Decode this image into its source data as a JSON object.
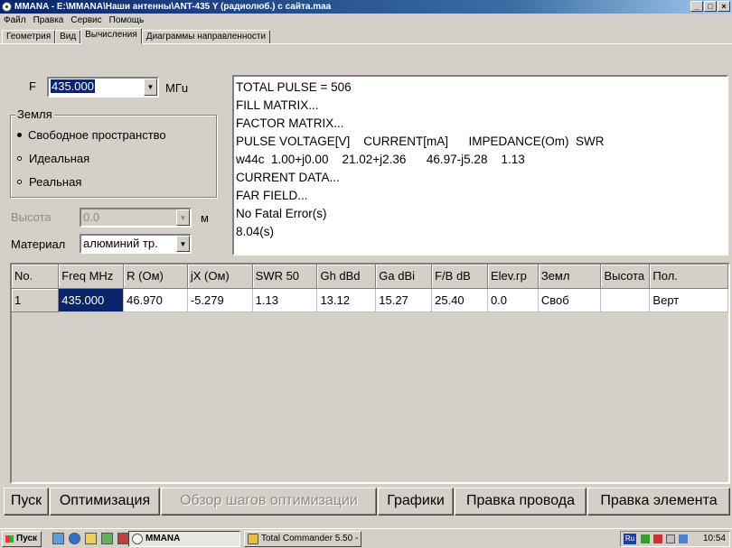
{
  "window": {
    "title": "MMANA - E:\\MMANA\\Наши антенны\\ANT-435 Y (радиолюб.) с сайта.maa",
    "minimize": "_",
    "maximize": "□",
    "close": "×"
  },
  "menu": [
    "Файл",
    "Правка",
    "Сервис",
    "Помощь"
  ],
  "tabs": [
    "Геометрия",
    "Вид",
    "Вычисления",
    "Диаграммы направленности"
  ],
  "active_tab": "Вычисления",
  "freq": {
    "label": "F",
    "value": "435.000",
    "unit": "MГu"
  },
  "ground": {
    "title": "Земля",
    "options": [
      "Свободное пространство",
      "Идеальная",
      "Реальная"
    ],
    "selected": "Свободное пространство"
  },
  "height": {
    "label": "Высота",
    "value": "0.0",
    "unit": "м"
  },
  "material": {
    "label": "Материал",
    "value": "алюминий тр."
  },
  "log_lines": [
    "TOTAL PULSE = 506",
    "FILL MATRIX...",
    "FACTOR MATRIX...",
    "PULSE VOLTAGE[V]    CURRENT[mA]      IMPEDANCE(Om)  SWR",
    "w44c  1.00+j0.00    21.02+j2.36      46.97-j5.28    1.13",
    "CURRENT DATA...",
    "FAR FIELD...",
    "No Fatal Error(s)",
    "8.04(s)"
  ],
  "grid": {
    "headers": [
      "No.",
      "Freq MHz",
      "R (Ом)",
      "jX (Ом)",
      "SWR 50",
      "Gh dBd",
      "Ga dBi",
      "F/B dB",
      "Elev.гр",
      "Земл",
      "Высота",
      "Пол."
    ],
    "rows": [
      [
        "1",
        "435.000",
        "46.970",
        "-5.279",
        "1.13",
        "13.12",
        "15.27",
        "25.40",
        "0.0",
        "Своб",
        "",
        "Верт"
      ]
    ]
  },
  "buttons": {
    "start": "Пуск",
    "optimize": "Оптимизация",
    "review": "Обзор шагов оптимизации",
    "graphs": "Графики",
    "edit_wire": "Правка провода",
    "edit_element": "Правка элемента"
  },
  "taskbar": {
    "start": "Пуск",
    "tasks": [
      "MMANA",
      "Total Commander 5.50 - R..."
    ],
    "lang": "Ru",
    "time": "10:54"
  }
}
